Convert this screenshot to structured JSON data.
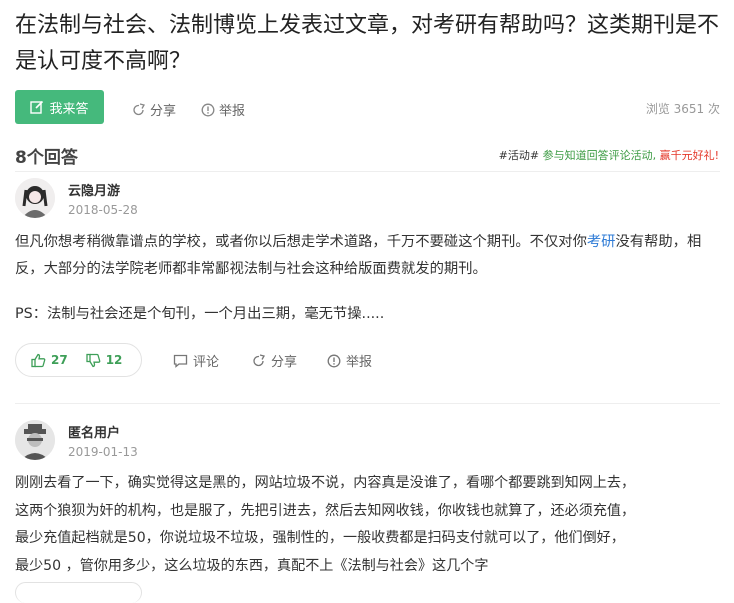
{
  "question": {
    "title": "在法制与社会、法制博览上发表过文章，对考研有帮助吗？这类期刊是不是认可度不高啊？"
  },
  "toolbar": {
    "answer_label": "我来答",
    "share_label": "分享",
    "report_label": "举报",
    "views": "浏览 3651 次"
  },
  "answers_header": {
    "count": "8个回答",
    "promo_tag": "#活动#",
    "promo_link": "参与知道回答评论活动,",
    "promo_gift": "赢千元好礼!"
  },
  "answers": [
    {
      "user": "云隐月游",
      "date": "2018-05-28",
      "text_before_link": "但凡你想考稍微靠谱点的学校，或者你以后想走学术道路，千万不要碰这个期刊。不仅对你",
      "link": "考研",
      "text_after_link": "没有帮助，相反，大部分的法学院老师都非常鄙视法制与社会这种给版面费就发的期刊。",
      "ps": "PS：法制与社会还是个旬刊，一个月出三期，毫无节操.....",
      "likes": "27",
      "dislikes": "12",
      "comment_label": "评论",
      "share_label": "分享",
      "report_label": "举报"
    },
    {
      "user": "匿名用户",
      "date": "2019-01-13",
      "lines": [
        "刚刚去看了一下，确实觉得这是黑的，网站垃圾不说，内容真是没谁了，看哪个都要跳到知网上去，",
        "这两个狼狈为奸的机构，也是服了，先把引进去，然后去知网收钱，你收钱也就算了，还必须充值，",
        "最少充值起档就是50，你说垃圾不垃圾，强制性的，一般收费都是扫码支付就可以了，他们倒好，",
        "最少50 ，管你用多少，这么垃圾的东西，真配不上《法制与社会》这几个字"
      ]
    }
  ],
  "colors": {
    "accent": "#45b97c",
    "link": "#2e7bd6",
    "promo": "#3c9b43",
    "gift": "#e4382a"
  }
}
